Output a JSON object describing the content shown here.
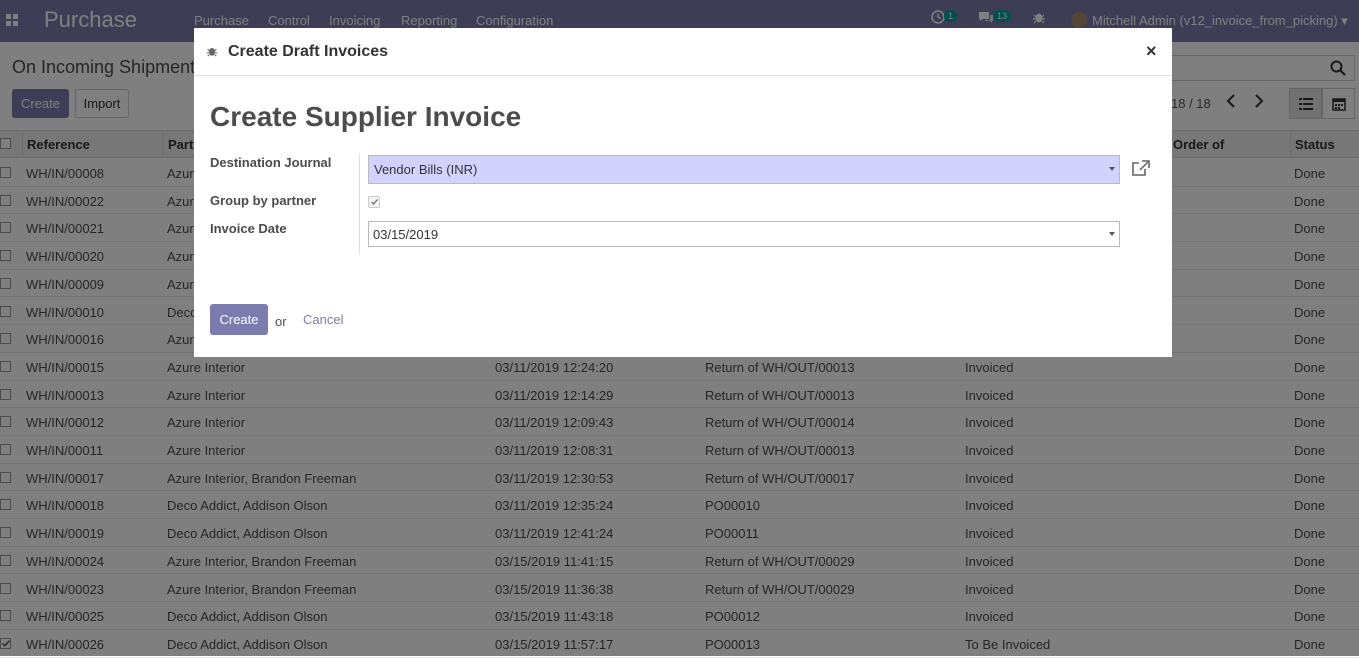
{
  "navbar": {
    "brand": "Purchase",
    "menu": [
      "Purchase",
      "Control",
      "Invoicing",
      "Reporting",
      "Configuration"
    ],
    "activity_badge": "1",
    "messages_badge": "13",
    "user": "Mitchell Admin (v12_invoice_from_picking)"
  },
  "control_panel": {
    "breadcrumb": "On Incoming Shipment",
    "create_label": "Create",
    "import_label": "Import",
    "pager": "18 / 18"
  },
  "list": {
    "headers": {
      "reference": "Reference",
      "partner": "Part",
      "order_of": "Order of",
      "status": "Status"
    },
    "rows": [
      {
        "ref": "WH/IN/00008",
        "partner": "Azur",
        "date": "",
        "origin": "",
        "invoice_state": "",
        "status": "Done",
        "checked": false
      },
      {
        "ref": "WH/IN/00022",
        "partner": "Azur",
        "date": "",
        "origin": "",
        "invoice_state": "",
        "status": "Done",
        "checked": false
      },
      {
        "ref": "WH/IN/00021",
        "partner": "Azur",
        "date": "",
        "origin": "",
        "invoice_state": "",
        "status": "Done",
        "checked": false
      },
      {
        "ref": "WH/IN/00020",
        "partner": "Azur",
        "date": "",
        "origin": "",
        "invoice_state": "",
        "status": "Done",
        "checked": false
      },
      {
        "ref": "WH/IN/00009",
        "partner": "Azur",
        "date": "",
        "origin": "",
        "invoice_state": "",
        "status": "Done",
        "checked": false
      },
      {
        "ref": "WH/IN/00010",
        "partner": "Deco",
        "date": "",
        "origin": "",
        "invoice_state": "",
        "status": "Done",
        "checked": false
      },
      {
        "ref": "WH/IN/00016",
        "partner": "Azur",
        "date": "",
        "origin": "",
        "invoice_state": "",
        "status": "Done",
        "checked": false
      },
      {
        "ref": "WH/IN/00015",
        "partner": "Azure Interior",
        "date": "03/11/2019 12:24:20",
        "origin": "Return of WH/OUT/00013",
        "invoice_state": "Invoiced",
        "status": "Done",
        "checked": false
      },
      {
        "ref": "WH/IN/00013",
        "partner": "Azure Interior",
        "date": "03/11/2019 12:14:29",
        "origin": "Return of WH/OUT/00013",
        "invoice_state": "Invoiced",
        "status": "Done",
        "checked": false
      },
      {
        "ref": "WH/IN/00012",
        "partner": "Azure Interior",
        "date": "03/11/2019 12:09:43",
        "origin": "Return of WH/OUT/00014",
        "invoice_state": "Invoiced",
        "status": "Done",
        "checked": false
      },
      {
        "ref": "WH/IN/00011",
        "partner": "Azure Interior",
        "date": "03/11/2019 12:08:31",
        "origin": "Return of WH/OUT/00013",
        "invoice_state": "Invoiced",
        "status": "Done",
        "checked": false
      },
      {
        "ref": "WH/IN/00017",
        "partner": "Azure Interior, Brandon Freeman",
        "date": "03/11/2019 12:30:53",
        "origin": "Return of WH/OUT/00017",
        "invoice_state": "Invoiced",
        "status": "Done",
        "checked": false
      },
      {
        "ref": "WH/IN/00018",
        "partner": "Deco Addict, Addison Olson",
        "date": "03/11/2019 12:35:24",
        "origin": "PO00010",
        "invoice_state": "Invoiced",
        "status": "Done",
        "checked": false
      },
      {
        "ref": "WH/IN/00019",
        "partner": "Deco Addict, Addison Olson",
        "date": "03/11/2019 12:41:24",
        "origin": "PO00011",
        "invoice_state": "Invoiced",
        "status": "Done",
        "checked": false
      },
      {
        "ref": "WH/IN/00024",
        "partner": "Azure Interior, Brandon Freeman",
        "date": "03/15/2019 11:41:15",
        "origin": "Return of WH/OUT/00029",
        "invoice_state": "Invoiced",
        "status": "Done",
        "checked": false
      },
      {
        "ref": "WH/IN/00023",
        "partner": "Azure Interior, Brandon Freeman",
        "date": "03/15/2019 11:36:38",
        "origin": "Return of WH/OUT/00029",
        "invoice_state": "Invoiced",
        "status": "Done",
        "checked": false
      },
      {
        "ref": "WH/IN/00025",
        "partner": "Deco Addict, Addison Olson",
        "date": "03/15/2019 11:43:18",
        "origin": "PO00012",
        "invoice_state": "Invoiced",
        "status": "Done",
        "checked": false
      },
      {
        "ref": "WH/IN/00026",
        "partner": "Deco Addict, Addison Olson",
        "date": "03/15/2019 11:57:17",
        "origin": "PO00013",
        "invoice_state": "To Be Invoiced",
        "status": "Done",
        "checked": true
      }
    ]
  },
  "modal": {
    "title": "Create Draft Invoices",
    "heading": "Create Supplier Invoice",
    "fields": {
      "journal_label": "Destination Journal",
      "journal_value": "Vendor Bills (INR)",
      "group_label": "Group by partner",
      "group_checked": true,
      "date_label": "Invoice Date",
      "date_value": "03/15/2019"
    },
    "create_label": "Create",
    "or_text": "or",
    "cancel_label": "Cancel"
  },
  "colors": {
    "brand": "#7c7bad",
    "journal_bg": "#d2d2ff",
    "badge": "#00a09d"
  }
}
